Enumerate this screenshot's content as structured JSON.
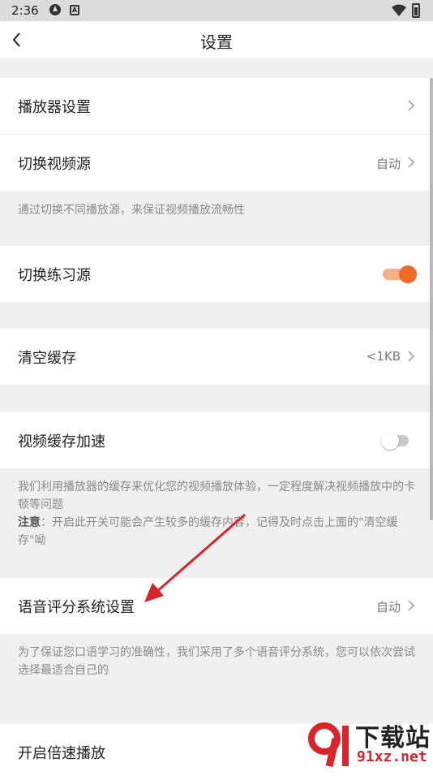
{
  "status_bar": {
    "time": "2:36",
    "notif_icon_1": "vpn-icon",
    "notif_icon_2": "app-a-icon",
    "wifi_icon": "wifi-icon",
    "battery_icon": "battery-icon"
  },
  "header": {
    "title": "设置",
    "back_icon": "back-chevron-icon"
  },
  "items": {
    "player_settings": {
      "label": "播放器设置"
    },
    "switch_video_source": {
      "label": "切换视频源",
      "value": "自动"
    },
    "video_source_note": "通过切换不同播放源，来保证视频播放流畅性",
    "switch_practice_source": {
      "label": "切换练习源",
      "enabled": true
    },
    "clear_cache": {
      "label": "清空缓存",
      "value": "<1KB"
    },
    "video_cache_accel": {
      "label": "视频缓存加速",
      "enabled": false
    },
    "cache_note_line1": "我们利用播放器的缓存来优化您的视频播放体验，一定程度解决视频播放中的卡顿等问题",
    "cache_note_bold": "注意",
    "cache_note_line2": "：开启此开关可能会产生较多的缓存内容，记得及时点击上面的\"清空缓存\"呦",
    "voice_scoring": {
      "label": "语音评分系统设置",
      "value": "自动"
    },
    "voice_note": "为了保证您口语学习的准确性，我们采用了多个语音评分系统，您可以依次尝试选择最适合自己的",
    "speed_playback": {
      "label": "开启倍速播放"
    }
  },
  "watermark": {
    "brand": "下载站",
    "domain": "91xz.net"
  },
  "colors": {
    "accent": "#f26a2a",
    "annotation_arrow": "#d9252a"
  }
}
